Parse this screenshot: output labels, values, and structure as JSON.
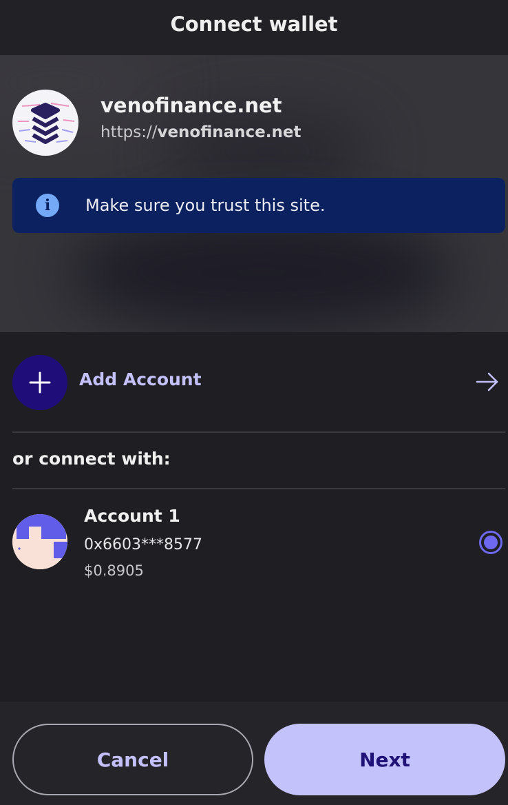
{
  "header": {
    "title": "Connect wallet"
  },
  "site": {
    "name": "venofinance.net",
    "url_prefix": "https://",
    "url_domain": "venofinance.net",
    "logo_icon": "veno-logo-icon"
  },
  "banner": {
    "icon": "info-icon",
    "icon_glyph": "i",
    "text": "Make sure you trust this site."
  },
  "add_account": {
    "label": "Add Account",
    "icon": "plus-icon",
    "arrow_icon": "arrow-right-icon"
  },
  "connect_with_label": "or connect with:",
  "accounts": [
    {
      "name": "Account 1",
      "address": "0x6603***8577",
      "balance": "$0.8905",
      "selected": true
    }
  ],
  "footer": {
    "cancel_label": "Cancel",
    "next_label": "Next"
  },
  "colors": {
    "accent": "#6e68f0",
    "accent_light": "#c4c2fb",
    "banner_bg": "#0c2260",
    "add_circle": "#1f0e7a",
    "background": "#1f1f23"
  }
}
